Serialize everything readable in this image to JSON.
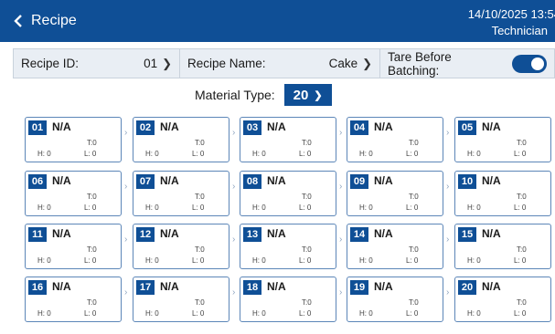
{
  "header": {
    "back_icon": "chevron-left-icon",
    "title": "Recipe",
    "datetime": "14/10/2025  13:54",
    "role": "Technician"
  },
  "params": {
    "recipe_id_label": "Recipe ID:",
    "recipe_id_value": "01",
    "recipe_name_label": "Recipe Name:",
    "recipe_name_value": "Cake",
    "tare_label": "Tare Before Batching:",
    "tare_enabled": true
  },
  "material_type": {
    "label": "Material Type:",
    "value": "20"
  },
  "colors": {
    "primary": "#0f4f96",
    "card_border": "#5c86b8",
    "param_bg": "#e9eef4"
  },
  "slots": [
    {
      "num": "01",
      "name": "N/A",
      "t": "T:0",
      "h": "H: 0",
      "l": "L: 0"
    },
    {
      "num": "02",
      "name": "N/A",
      "t": "T:0",
      "h": "H: 0",
      "l": "L: 0"
    },
    {
      "num": "03",
      "name": "N/A",
      "t": "T:0",
      "h": "H: 0",
      "l": "L: 0"
    },
    {
      "num": "04",
      "name": "N/A",
      "t": "T:0",
      "h": "H: 0",
      "l": "L: 0"
    },
    {
      "num": "05",
      "name": "N/A",
      "t": "T:0",
      "h": "H: 0",
      "l": "L: 0"
    },
    {
      "num": "06",
      "name": "N/A",
      "t": "T:0",
      "h": "H: 0",
      "l": "L: 0"
    },
    {
      "num": "07",
      "name": "N/A",
      "t": "T:0",
      "h": "H: 0",
      "l": "L: 0"
    },
    {
      "num": "08",
      "name": "N/A",
      "t": "T:0",
      "h": "H: 0",
      "l": "L: 0"
    },
    {
      "num": "09",
      "name": "N/A",
      "t": "T:0",
      "h": "H: 0",
      "l": "L: 0"
    },
    {
      "num": "10",
      "name": "N/A",
      "t": "T:0",
      "h": "H: 0",
      "l": "L: 0"
    },
    {
      "num": "11",
      "name": "N/A",
      "t": "T:0",
      "h": "H: 0",
      "l": "L: 0"
    },
    {
      "num": "12",
      "name": "N/A",
      "t": "T:0",
      "h": "H: 0",
      "l": "L: 0"
    },
    {
      "num": "13",
      "name": "N/A",
      "t": "T:0",
      "h": "H: 0",
      "l": "L: 0"
    },
    {
      "num": "14",
      "name": "N/A",
      "t": "T:0",
      "h": "H: 0",
      "l": "L: 0"
    },
    {
      "num": "15",
      "name": "N/A",
      "t": "T:0",
      "h": "H: 0",
      "l": "L: 0"
    },
    {
      "num": "16",
      "name": "N/A",
      "t": "T:0",
      "h": "H: 0",
      "l": "L: 0"
    },
    {
      "num": "17",
      "name": "N/A",
      "t": "T:0",
      "h": "H: 0",
      "l": "L: 0"
    },
    {
      "num": "18",
      "name": "N/A",
      "t": "T:0",
      "h": "H: 0",
      "l": "L: 0"
    },
    {
      "num": "19",
      "name": "N/A",
      "t": "T:0",
      "h": "H: 0",
      "l": "L: 0"
    },
    {
      "num": "20",
      "name": "N/A",
      "t": "T:0",
      "h": "H: 0",
      "l": "L: 0"
    }
  ]
}
